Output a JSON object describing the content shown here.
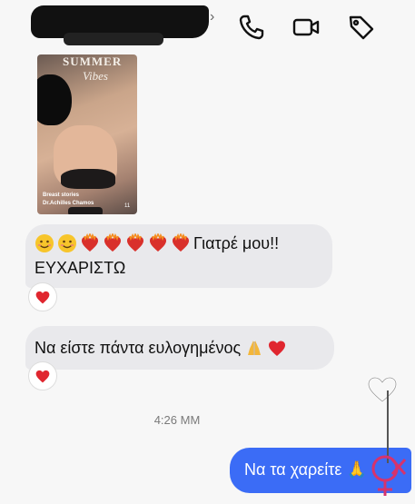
{
  "header": {
    "chevron": "›",
    "icons": [
      "phone-icon",
      "video-camera-icon",
      "tag-icon"
    ]
  },
  "story": {
    "logo_line1": "SUMMER",
    "logo_line2": "Vibes",
    "caption_line1": "Breast stories",
    "caption_line2": "Dr.Achilles Chamos",
    "caption_mark": "11"
  },
  "messages": {
    "incoming_1": {
      "emoji_row": [
        "smiling-face",
        "smiling-face",
        "heart-on-fire",
        "heart-on-fire",
        "heart-on-fire",
        "heart-on-fire",
        "heart-on-fire"
      ],
      "text_line1": "Γιατρέ μου!!",
      "text_line2": "ΕΥΧΑΡΙΣΤΩ",
      "reaction": "red-heart"
    },
    "incoming_2": {
      "text": "Να είστε πάντα ευλογημένος",
      "emojis": [
        "folded-hands",
        "red-heart"
      ],
      "reaction": "red-heart"
    },
    "timestamp": "4:26 ΜΜ",
    "outgoing_1": {
      "text": "Να τα χαρείτε 🙏"
    }
  },
  "colors": {
    "incoming_bubble": "#e9e9ec",
    "outgoing_bubble": "#3b6cf6",
    "heart": "#e0262f",
    "watermark": "#d6336c"
  }
}
